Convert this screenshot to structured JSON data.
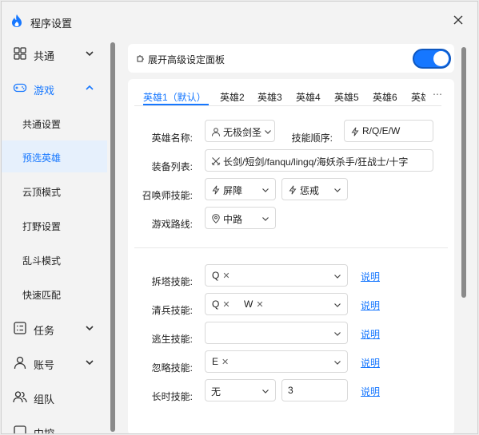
{
  "window": {
    "title": "程序设置"
  },
  "sidebar": {
    "items": [
      {
        "label": "共通",
        "icon": "grid-icon"
      },
      {
        "label": "游戏",
        "icon": "gamepad-icon"
      },
      {
        "label": "任务",
        "icon": "task-list-icon"
      },
      {
        "label": "账号",
        "icon": "user-icon"
      },
      {
        "label": "组队",
        "icon": "team-icon"
      },
      {
        "label": "中控",
        "icon": "control-icon"
      }
    ],
    "sub_items": [
      "共通设置",
      "预选英雄",
      "云顶模式",
      "打野设置",
      "乱斗模式",
      "快速匹配"
    ]
  },
  "advanced": {
    "label": "展开高级设定面板",
    "enabled": true
  },
  "tabs": [
    "英雄1（默认）",
    "英雄2",
    "英雄3",
    "英雄4",
    "英雄5",
    "英雄6",
    "英雄"
  ],
  "tab_more": "⋯",
  "form": {
    "hero_name_label": "英雄名称:",
    "hero_name_value": "无极剑圣",
    "skill_order_label": "技能顺序:",
    "skill_order_value": "R/Q/E/W",
    "equipment_label": "装备列表:",
    "equipment_value": "长剑/短剑/fanqu/lingq/海妖杀手/狂战士/十字",
    "summoner_label": "召唤师技能:",
    "summoner_1": "屏障",
    "summoner_2": "惩戒",
    "route_label": "游戏路线:",
    "route_value": "中路"
  },
  "skills": {
    "tower_label": "拆塔技能:",
    "tower_tags": [
      "Q"
    ],
    "minion_label": "清兵技能:",
    "minion_tags": [
      "Q",
      "W"
    ],
    "escape_label": "逃生技能:",
    "ignore_label": "忽略技能:",
    "ignore_tags": [
      "E"
    ],
    "long_label": "长时技能:",
    "long_select": "无",
    "long_value": "3",
    "explain": "说明"
  },
  "colors": {
    "accent": "#1677ff",
    "selected_bg": "#e6f0fc"
  }
}
